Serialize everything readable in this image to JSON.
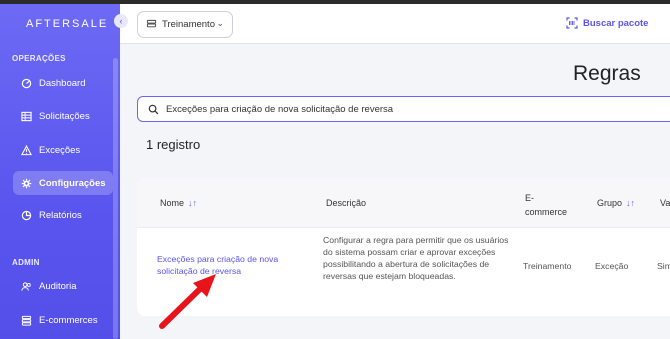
{
  "sidebar": {
    "logo": "AFTERSALE",
    "collapse_icon": "chevron-left-icon",
    "sections": [
      {
        "label": "OPERAÇÕES"
      },
      {
        "label": "ADMIN"
      }
    ],
    "items": [
      {
        "label": "Dashboard",
        "icon": "dashboard-icon"
      },
      {
        "label": "Solicitações",
        "icon": "table-icon"
      },
      {
        "label": "Exceções",
        "icon": "warning-icon"
      },
      {
        "label": "Configurações",
        "icon": "gear-icon",
        "active": true
      },
      {
        "label": "Relatórios",
        "icon": "report-icon"
      },
      {
        "label": "Auditoria",
        "icon": "users-icon"
      },
      {
        "label": "E-commerces",
        "icon": "store-icon"
      }
    ]
  },
  "header": {
    "workspace": "Treinamento",
    "search_package": "Buscar pacote"
  },
  "main": {
    "title": "Regras",
    "search_value": "Exceções para criação de nova solicitação de reversa",
    "count": "1 registro",
    "table": {
      "columns": [
        "Nome",
        "Descrição",
        "E-\ncommerce",
        "Grupo",
        "Va"
      ],
      "rows": [
        {
          "nome": "Exceções para criação de nova solicitação de reversa",
          "descricao": "Configurar a regra para permitir que os usuários do sistema possam criar e aprovar exceções possibilitando a abertura de solicitações de reversas que estejam bloqueadas.",
          "ecommerce": "Treinamento",
          "grupo": "Exceção",
          "valor": "Sim"
        }
      ]
    }
  },
  "colors": {
    "accent": "#5a55ee",
    "annotation_arrow": "#e8141c"
  }
}
